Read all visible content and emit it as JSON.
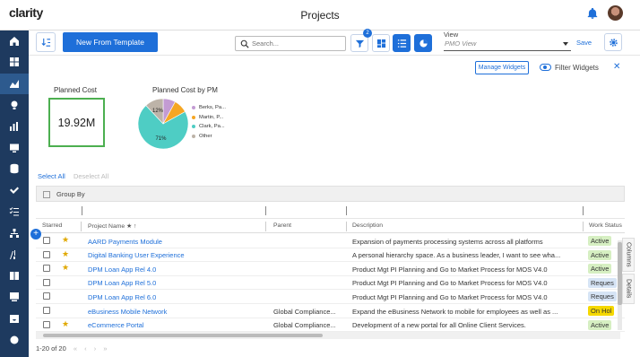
{
  "app": {
    "logo": "clarity",
    "page_title": "Projects"
  },
  "sidebar": {
    "items": [
      {
        "icon": "home-icon"
      },
      {
        "icon": "dashboard-icon"
      },
      {
        "icon": "projects-icon",
        "active": true
      },
      {
        "icon": "ideas-icon"
      },
      {
        "icon": "reports-icon"
      },
      {
        "icon": "monitor-icon"
      },
      {
        "icon": "database-icon"
      },
      {
        "icon": "checkmark-icon"
      },
      {
        "icon": "checklist-icon"
      },
      {
        "icon": "hierarchy-icon"
      },
      {
        "icon": "roadmap-icon"
      },
      {
        "icon": "book-icon"
      },
      {
        "icon": "monitor-alt-icon"
      },
      {
        "icon": "inbox-icon"
      },
      {
        "icon": "settings-icon"
      }
    ]
  },
  "toolbar": {
    "new_from_template": "New From Template",
    "search_placeholder": "Search...",
    "filter_badge": "2",
    "view_label": "View",
    "view_value": "PMO View",
    "save_label": "Save"
  },
  "widgets": {
    "manage_label": "Manage Widgets",
    "filter_label": "Filter Widgets",
    "close_label": "✕",
    "planned_cost_title": "Planned Cost",
    "planned_cost_value": "19.92M",
    "pie_title": "Planned Cost by PM",
    "pie_legend": [
      "Berks, Pa...",
      "Martin, P...",
      "Clark, Pa...",
      "Other"
    ]
  },
  "chart_data": {
    "type": "pie",
    "title": "Planned Cost by PM",
    "categories": [
      "Berks, Pa...",
      "Martin, P...",
      "Clark, Pa...",
      "Other"
    ],
    "values": [
      8,
      9,
      71,
      12
    ],
    "colors": [
      "#c39bd3",
      "#f5a623",
      "#4ecdc4",
      "#bdb3a8"
    ],
    "slice_labels": [
      "",
      "",
      "71%",
      "12%"
    ],
    "legend": "right"
  },
  "grid": {
    "select_all": "Select All",
    "deselect_all": "Deselect All",
    "group_by": "Group By",
    "columns": {
      "starred": "Starred",
      "name": "Project Name ★ ↑",
      "parent": "Parent",
      "description": "Description",
      "status": "Work Status"
    },
    "rows": [
      {
        "starred": true,
        "name": "AARD Payments Module",
        "parent": "",
        "description": "Expansion of payments processing systems across all platforms",
        "status": "Active"
      },
      {
        "starred": true,
        "name": "Digital Banking User Experience",
        "parent": "",
        "description": "A personal hierarchy space. As a business leader, I want to see wha...",
        "status": "Active"
      },
      {
        "starred": true,
        "name": "DPM Loan App Rel 4.0",
        "parent": "",
        "description": "Product Mgt PI Planning and Go to Market Process for MOS V4.0",
        "status": "Active"
      },
      {
        "starred": false,
        "name": "DPM Loan App Rel 5.0",
        "parent": "",
        "description": "Product Mgt PI Planning and Go to Market Process for MOS V4.0",
        "status": "Reques"
      },
      {
        "starred": false,
        "name": "DPM Loan App Rel 6.0",
        "parent": "",
        "description": "Product Mgt PI Planning and Go to Market Process for MOS V4.0",
        "status": "Reques"
      },
      {
        "starred": false,
        "name": "eBusiness Mobile Network",
        "parent": "Global Compliance...",
        "description": "Expand the eBusiness Network to mobile for employees as well as ...",
        "status": "On Hol"
      },
      {
        "starred": true,
        "name": "eCommerce Portal",
        "parent": "Global Compliance...",
        "description": "Development of a new portal for all Online Client Services.",
        "status": "Active"
      }
    ],
    "status_colors": {
      "Active": "#d6efc2",
      "Reques": "#d6e4f5",
      "On Hol": "#f5d800"
    },
    "pager": "1-20 of 20",
    "side_tabs": [
      "Columns",
      "Details"
    ]
  }
}
